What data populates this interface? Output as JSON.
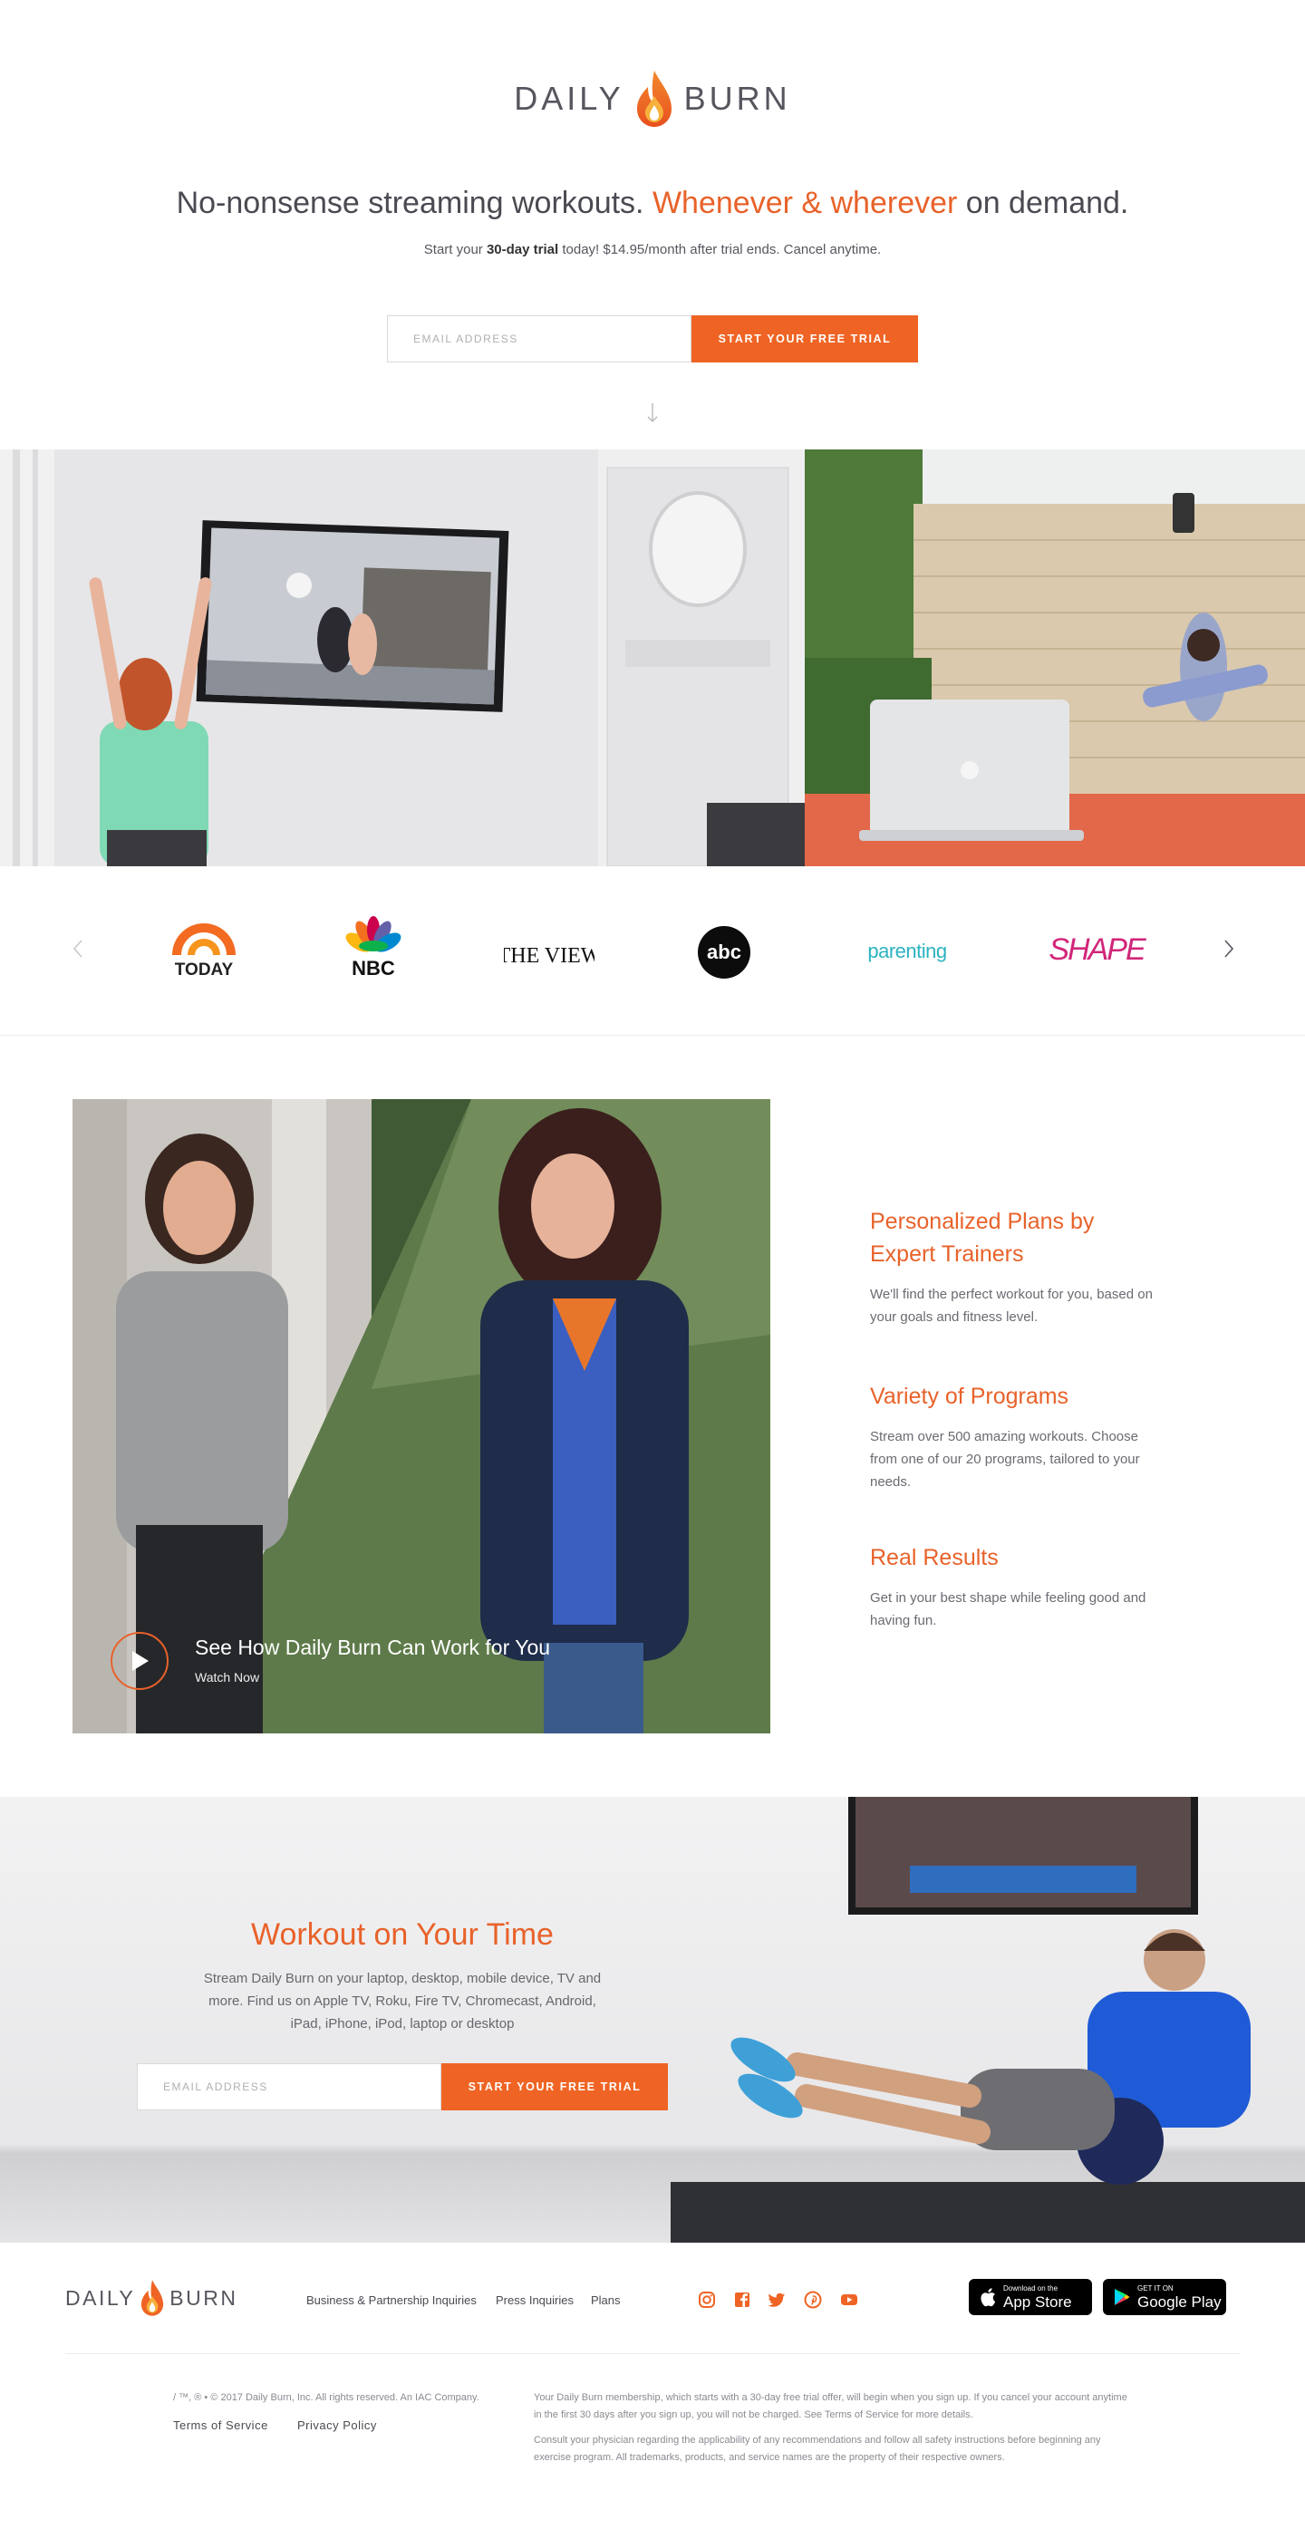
{
  "brand": {
    "name_left": "DAILY",
    "name_right": "BURN",
    "accent": "#ef6424",
    "accent_text": "#e8622a"
  },
  "hero": {
    "title_part1": "No-nonsense streaming workouts.",
    "title_highlight": "Whenever & wherever",
    "title_part2": "on demand.",
    "sub_prefix": "Start your",
    "sub_bold": "30-day trial",
    "sub_suffix": "today!  $14.95/month after trial ends. Cancel anytime.",
    "email_placeholder": "EMAIL ADDRESS",
    "cta_label": "START YOUR FREE TRIAL",
    "scroll_icon": "arrow-down-icon"
  },
  "press": {
    "logos": [
      "TODAY",
      "NBC",
      "THE VIEW",
      "abc",
      "parenting",
      "SHAPE"
    ],
    "prev_icon": "chevron-left-icon",
    "next_icon": "chevron-right-icon"
  },
  "video": {
    "title": "See How Daily Burn Can Work for You",
    "subtitle": "Watch Now",
    "play_icon": "play-icon"
  },
  "features": [
    {
      "title": "Personalized Plans by Expert Trainers",
      "text": "We'll find the perfect workout for you, based on your goals and fitness level."
    },
    {
      "title": "Variety of Programs",
      "text": "Stream over 500 amazing workouts. Choose from one of our 20 programs, tailored to your needs."
    },
    {
      "title": "Real Results",
      "text": "Get in your best shape while feeling good and having fun."
    }
  ],
  "workout": {
    "title": "Workout on Your Time",
    "text": "Stream Daily Burn on your laptop, desktop, mobile device, TV and more. Find us on Apple TV, Roku, Fire TV, Chromecast, Android, iPad, iPhone, iPod, laptop or desktop",
    "email_placeholder": "EMAIL ADDRESS",
    "cta_label": "START YOUR FREE TRIAL"
  },
  "footer": {
    "links": [
      "Business & Partnership Inquiries",
      "Press Inquiries",
      "Plans"
    ],
    "social_icons": [
      "instagram-icon",
      "facebook-icon",
      "twitter-icon",
      "pinterest-icon",
      "youtube-icon"
    ],
    "app_store": {
      "small": "Download on the",
      "big": "App Store"
    },
    "google_play": {
      "small": "GET IT ON",
      "big": "Google Play"
    },
    "copyright": "/ ™, ® • © 2017 Daily Burn, Inc. All rights reserved. An IAC Company.",
    "terms": "Terms of Service",
    "privacy": "Privacy Policy",
    "disclaimer1": "Your Daily Burn membership, which starts with a 30-day free trial offer, will begin when you sign up. If you cancel your account anytime in the first 30 days after you sign up, you will not be charged. See Terms of Service for more details.",
    "disclaimer2": "Consult your physician regarding the applicability of any recommendations and follow all safety instructions before beginning any exercise program. All trademarks, products, and service names are the property of their respective owners."
  }
}
